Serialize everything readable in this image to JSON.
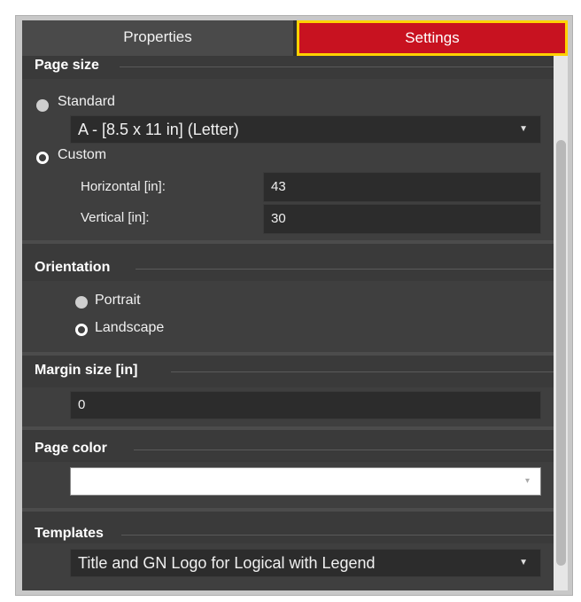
{
  "tabs": {
    "properties": "Properties",
    "settings": "Settings"
  },
  "page_size": {
    "title": "Page size",
    "standard_label": "Standard",
    "standard_selected_value": "A - [8.5 x 11 in] (Letter)",
    "custom_label": "Custom",
    "selected": "custom",
    "horizontal_label": "Horizontal [in]:",
    "horizontal_value": "43",
    "vertical_label": "Vertical [in]:",
    "vertical_value": "30"
  },
  "orientation": {
    "title": "Orientation",
    "portrait_label": "Portrait",
    "landscape_label": "Landscape",
    "selected": "landscape"
  },
  "margin": {
    "title": "Margin size [in]",
    "value": "0"
  },
  "page_color": {
    "title": "Page color",
    "value": "#ffffff"
  },
  "templates": {
    "title": "Templates",
    "selected_value": "Title and GN Logo for Logical with Legend"
  },
  "colors": {
    "settings_tab": "#c81220",
    "highlight_border": "#ffd200",
    "panel_bg": "#3b3b3b"
  }
}
